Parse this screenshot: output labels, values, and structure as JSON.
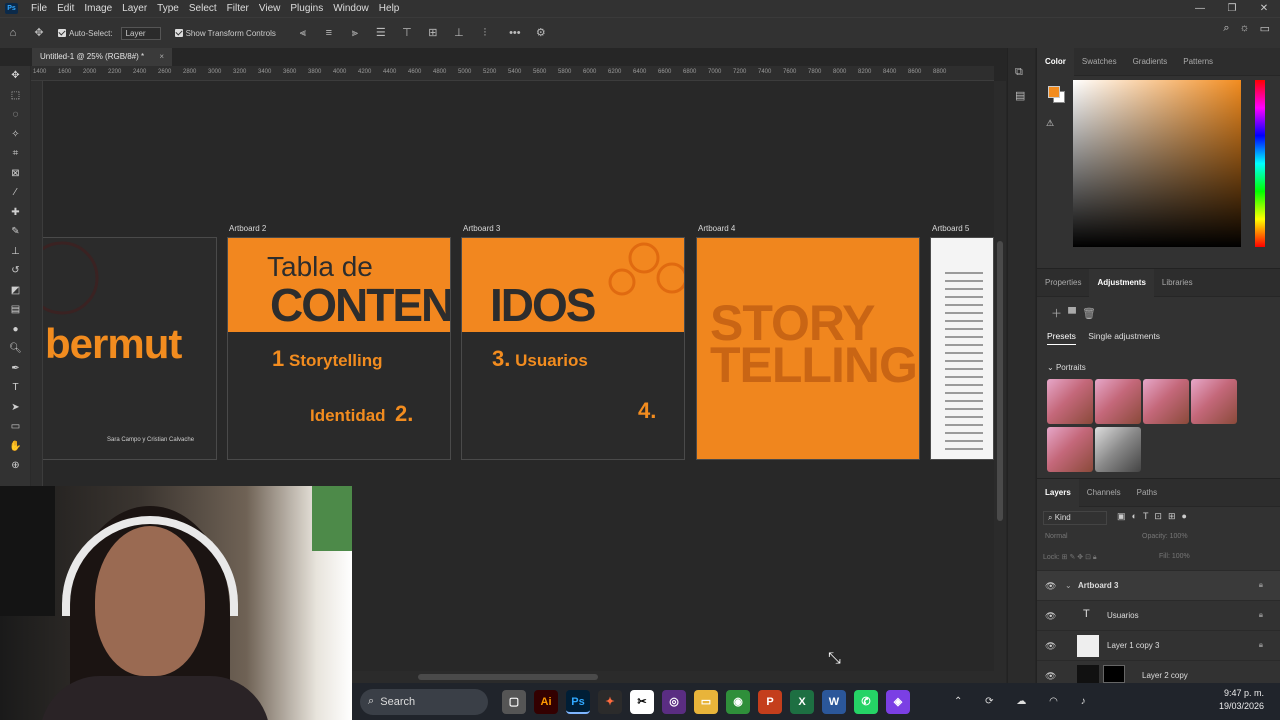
{
  "menubar": {
    "logo": "Ps",
    "items": [
      "File",
      "Edit",
      "Image",
      "Layer",
      "Type",
      "Select",
      "Filter",
      "View",
      "Plugins",
      "Window",
      "Help"
    ]
  },
  "options_bar": {
    "auto_select_label": "Auto-Select:",
    "auto_select_value": "Layer",
    "transform_label": "Show Transform Controls"
  },
  "document": {
    "tab_title": "Untitled-1 @ 25% (RGB/8#) *"
  },
  "ruler": {
    "ticks": [
      "1400",
      "1600",
      "2000",
      "2200",
      "2400",
      "2600",
      "2800",
      "3000",
      "3200",
      "3400",
      "3600",
      "3800",
      "4000",
      "4200",
      "4400",
      "4600",
      "4800",
      "5000",
      "5200",
      "5400",
      "5600",
      "5800",
      "6000",
      "6200",
      "6400",
      "6600",
      "6800",
      "7000",
      "7200",
      "7400",
      "7600",
      "7800",
      "8000",
      "8200",
      "8400",
      "8600",
      "8800"
    ]
  },
  "artboards": {
    "labels": [
      "Artboard 2",
      "Artboard 3",
      "Artboard 4",
      "Artboard 5"
    ],
    "ab1": {
      "brand": "bermut",
      "credits": "Sara Campo y Cristian Calvache"
    },
    "ab2": {
      "title_top": "Tabla de",
      "title_big": "CONTENIDOS",
      "item1_num": "1",
      "item1_text": "Storytelling",
      "item2_text": "Identidad",
      "item2_num": "2."
    },
    "ab3": {
      "title_big": "IDOS",
      "item3_num": "3.",
      "item3_text": "Usuarios",
      "item4_num": "4."
    },
    "ab4": {
      "line1": "STORY",
      "line2": "TELLING"
    }
  },
  "color_panel": {
    "tabs": [
      "Color",
      "Swatches",
      "Gradients",
      "Patterns"
    ],
    "foreground": "#f28c1f",
    "background": "#ffffff"
  },
  "adjustments_panel": {
    "tabs": [
      "Properties",
      "Adjustments",
      "Libraries"
    ],
    "subtabs": [
      "Presets",
      "Single adjustments"
    ],
    "group": "Portraits"
  },
  "layers_panel": {
    "tabs": [
      "Layers",
      "Channels",
      "Paths"
    ],
    "filter": "Kind",
    "blend_mode": "Normal",
    "opacity_label": "Opacity:",
    "opacity_value": "100%",
    "lock_label": "Lock:",
    "fill_label": "Fill:",
    "fill_value": "100%",
    "layers": [
      "Artboard 3",
      "Usuarios",
      "Layer 1 copy 3",
      "Layer 2 copy"
    ]
  },
  "taskbar": {
    "search": "Search",
    "time": "9:47 p. m.",
    "date": "19/03/2026"
  }
}
